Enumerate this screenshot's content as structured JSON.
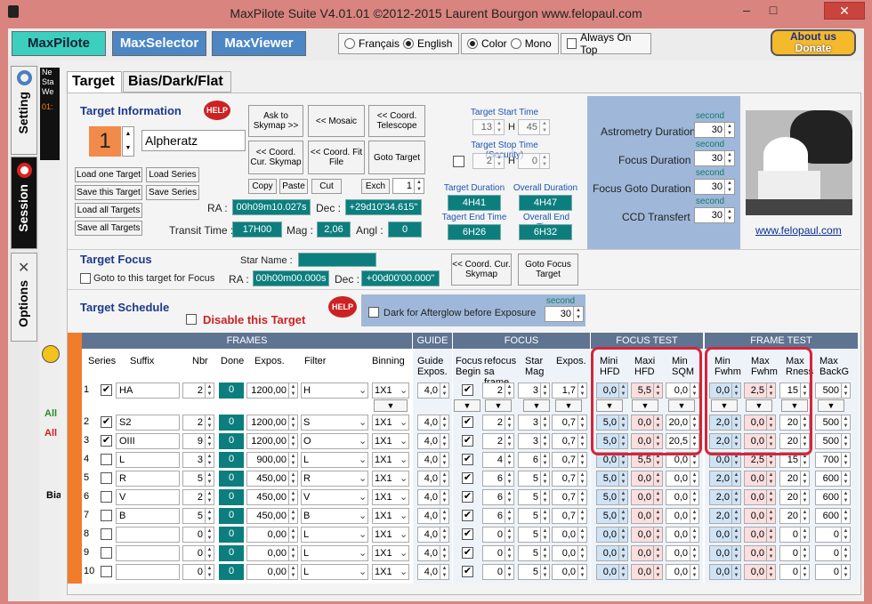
{
  "window": {
    "title": "MaxPilote Suite  V4.01.01  ©2012-2015 Laurent Bourgon  www.felopaul.com",
    "min": "–",
    "max": "□",
    "close": "✕"
  },
  "apps": {
    "maxpilote": "MaxPilote",
    "maxselector": "MaxSelector",
    "maxviewer": "MaxViewer"
  },
  "lang": {
    "fr": "Français",
    "en": "English"
  },
  "display": {
    "color": "Color",
    "mono": "Mono"
  },
  "always_on_top": "Always On Top",
  "about": {
    "line1": "About us",
    "line2": "Donate",
    "amp": "&"
  },
  "sidebar": {
    "setting": "Setting",
    "session": "Session",
    "options": "Options"
  },
  "col2": {
    "t1": "Ne",
    "t2": "Sta",
    "t3": "We",
    "t4": "01:",
    "all1": "All",
    "all2": "All",
    "bia": "Bia"
  },
  "tabs": {
    "target": "Target",
    "bias": "Bias/Dark/Flat"
  },
  "target_info": {
    "title": "Target Information",
    "help": "HELP",
    "number": "1",
    "name": "Alpheratz",
    "ask_skymap": "Ask to Skymap >>",
    "mosaic": "<< Mosaic",
    "coord_telescope": "<< Coord. Telescope",
    "coord_cur_skymap": "<< Coord. Cur. Skymap",
    "coord_fit": "<< Coord. Fit File",
    "goto_target": "Goto Target",
    "copy": "Copy",
    "paste": "Paste",
    "cut": "Cut",
    "exch": "Exch",
    "exch_val": "1",
    "load_one": "Load one Target",
    "load_series": "Load Series",
    "save_this": "Save this Target",
    "save_series": "Save Series",
    "load_all": "Load all Targets",
    "save_all": "Save all Targets",
    "ra_label": "RA :",
    "ra": "00h09m10.027s",
    "dec_label": "Dec :",
    "dec": "+29d10'34.615\"",
    "transit_label": "Transit Time :",
    "transit": "17H00",
    "mag_label": "Mag :",
    "mag": "2,06",
    "angl_label": "Angl :",
    "angl": "0"
  },
  "times": {
    "start_label": "Target Start Time",
    "start_h": "13",
    "start_m": "45",
    "h": "H",
    "stop_label": "Target Stop Time (Security)",
    "stop_h": "2",
    "stop_m": "0",
    "duration_label": "Target Duration",
    "duration": "4H41",
    "overall_label": "Overall Duration",
    "overall": "4H47",
    "end_label": "Tagert End Time",
    "end": "6H26",
    "overall_end_label": "Overall End Time",
    "overall_end": "6H32"
  },
  "durations": {
    "second": "second",
    "astrometry": "Astrometry Duration :",
    "astrometry_v": "30",
    "focus": "Focus Duration :",
    "focus_v": "30",
    "focus_goto": "Focus  Goto Duration :",
    "focus_goto_v": "30",
    "ccd": "CCD Transfert :",
    "ccd_v": "30"
  },
  "website": "www.felopaul.com",
  "target_focus": {
    "title": "Target Focus",
    "star_name": "Star Name :",
    "goto_label": "Goto to this target for Focus",
    "ra_label": "RA :",
    "ra": "00h00m00.000s",
    "dec_label": "Dec :",
    "dec": "+00d00'00.000\"",
    "coord_skymap": "<< Coord. Cur. Skymap",
    "goto_focus": "Goto Focus Target"
  },
  "schedule": {
    "title": "Target Schedule",
    "disable": "Disable this Target",
    "help": "HELP",
    "dark_label": "Dark for Afterglow  before Exposure",
    "second": "second",
    "dark_v": "30"
  },
  "table": {
    "groups": {
      "frames": "FRAMES",
      "guide": "GUIDE",
      "focus": "FOCUS",
      "focus_test": "FOCUS TEST",
      "frame_test": "FRAME TEST"
    },
    "cols": {
      "series": "Series",
      "suffix": "Suffix",
      "nbr": "Nbr",
      "done": "Done",
      "expos": "Expos.",
      "filter": "Filter",
      "binning": "Binning",
      "guide_expos": "Guide Expos.",
      "focus_begin": "Focus Begin",
      "refocus": "refocus sa frame",
      "star_mag": "Star Mag",
      "fexpos": "Expos.",
      "mini_hfd": "Mini HFD",
      "maxi_hfd": "Maxi HFD",
      "min_sqm": "Min SQM",
      "min_fwhm": "Min Fwhm",
      "max_fwhm": "Max Fwhm",
      "max_rness": "Max Rness",
      "max_backg": "Max BackG"
    },
    "rows": [
      {
        "n": "1",
        "chk": "✔",
        "suffix": "HA",
        "nbr": "2",
        "done": "0",
        "expos": "1200,00",
        "filter": "H",
        "bin": "1X1",
        "guide": "4,0",
        "fb": "✔",
        "refocus": "2",
        "mag": "3",
        "fexp": "1,7",
        "mhfd": "0,0",
        "xhfd": "5,5",
        "sqm": "0,0",
        "mfw": "0,0",
        "xfw": "2,5",
        "rn": "15",
        "bg": "500"
      },
      {
        "n": "2",
        "chk": "✔",
        "suffix": "S2",
        "nbr": "2",
        "done": "0",
        "expos": "1200,00",
        "filter": "S",
        "bin": "1X1",
        "guide": "4,0",
        "fb": "✔",
        "refocus": "2",
        "mag": "3",
        "fexp": "0,7",
        "mhfd": "5,0",
        "xhfd": "0,0",
        "sqm": "20,0",
        "mfw": "2,0",
        "xfw": "0,0",
        "rn": "20",
        "bg": "500"
      },
      {
        "n": "3",
        "chk": "✔",
        "suffix": "OIII",
        "nbr": "9",
        "done": "0",
        "expos": "1200,00",
        "filter": "O",
        "bin": "1X1",
        "guide": "4,0",
        "fb": "✔",
        "refocus": "2",
        "mag": "3",
        "fexp": "0,7",
        "mhfd": "5,0",
        "xhfd": "0,0",
        "sqm": "20,5",
        "mfw": "2,0",
        "xfw": "0,0",
        "rn": "20",
        "bg": "500"
      },
      {
        "n": "4",
        "chk": "",
        "suffix": "L",
        "nbr": "3",
        "done": "0",
        "expos": "900,00",
        "filter": "L",
        "bin": "1X1",
        "guide": "4,0",
        "fb": "✔",
        "refocus": "4",
        "mag": "6",
        "fexp": "0,7",
        "mhfd": "0,0",
        "xhfd": "5,5",
        "sqm": "0,0",
        "mfw": "0,0",
        "xfw": "2,5",
        "rn": "15",
        "bg": "700"
      },
      {
        "n": "5",
        "chk": "",
        "suffix": "R",
        "nbr": "5",
        "done": "0",
        "expos": "450,00",
        "filter": "R",
        "bin": "1X1",
        "guide": "4,0",
        "fb": "✔",
        "refocus": "6",
        "mag": "5",
        "fexp": "0,7",
        "mhfd": "5,0",
        "xhfd": "0,0",
        "sqm": "0,0",
        "mfw": "2,0",
        "xfw": "0,0",
        "rn": "20",
        "bg": "600"
      },
      {
        "n": "6",
        "chk": "",
        "suffix": "V",
        "nbr": "2",
        "done": "0",
        "expos": "450,00",
        "filter": "V",
        "bin": "1X1",
        "guide": "4,0",
        "fb": "✔",
        "refocus": "6",
        "mag": "5",
        "fexp": "0,7",
        "mhfd": "5,0",
        "xhfd": "0,0",
        "sqm": "0,0",
        "mfw": "2,0",
        "xfw": "0,0",
        "rn": "20",
        "bg": "600"
      },
      {
        "n": "7",
        "chk": "",
        "suffix": "B",
        "nbr": "5",
        "done": "0",
        "expos": "450,00",
        "filter": "B",
        "bin": "1X1",
        "guide": "4,0",
        "fb": "✔",
        "refocus": "6",
        "mag": "5",
        "fexp": "0,7",
        "mhfd": "5,0",
        "xhfd": "0,0",
        "sqm": "0,0",
        "mfw": "2,0",
        "xfw": "0,0",
        "rn": "20",
        "bg": "600"
      },
      {
        "n": "8",
        "chk": "",
        "suffix": "",
        "nbr": "0",
        "done": "0",
        "expos": "0,00",
        "filter": "L",
        "bin": "1X1",
        "guide": "4,0",
        "fb": "✔",
        "refocus": "0",
        "mag": "5",
        "fexp": "0,0",
        "mhfd": "0,0",
        "xhfd": "0,0",
        "sqm": "0,0",
        "mfw": "0,0",
        "xfw": "0,0",
        "rn": "0",
        "bg": "0"
      },
      {
        "n": "9",
        "chk": "",
        "suffix": "",
        "nbr": "0",
        "done": "0",
        "expos": "0,00",
        "filter": "L",
        "bin": "1X1",
        "guide": "4,0",
        "fb": "✔",
        "refocus": "0",
        "mag": "5",
        "fexp": "0,0",
        "mhfd": "0,0",
        "xhfd": "0,0",
        "sqm": "0,0",
        "mfw": "0,0",
        "xfw": "0,0",
        "rn": "0",
        "bg": "0"
      },
      {
        "n": "10",
        "chk": "",
        "suffix": "",
        "nbr": "0",
        "done": "0",
        "expos": "0,00",
        "filter": "L",
        "bin": "1X1",
        "guide": "4,0",
        "fb": "✔",
        "refocus": "0",
        "mag": "5",
        "fexp": "0,0",
        "mhfd": "0,0",
        "xhfd": "0,0",
        "sqm": "0,0",
        "mfw": "0,0",
        "xfw": "0,0",
        "rn": "0",
        "bg": "0"
      }
    ]
  }
}
